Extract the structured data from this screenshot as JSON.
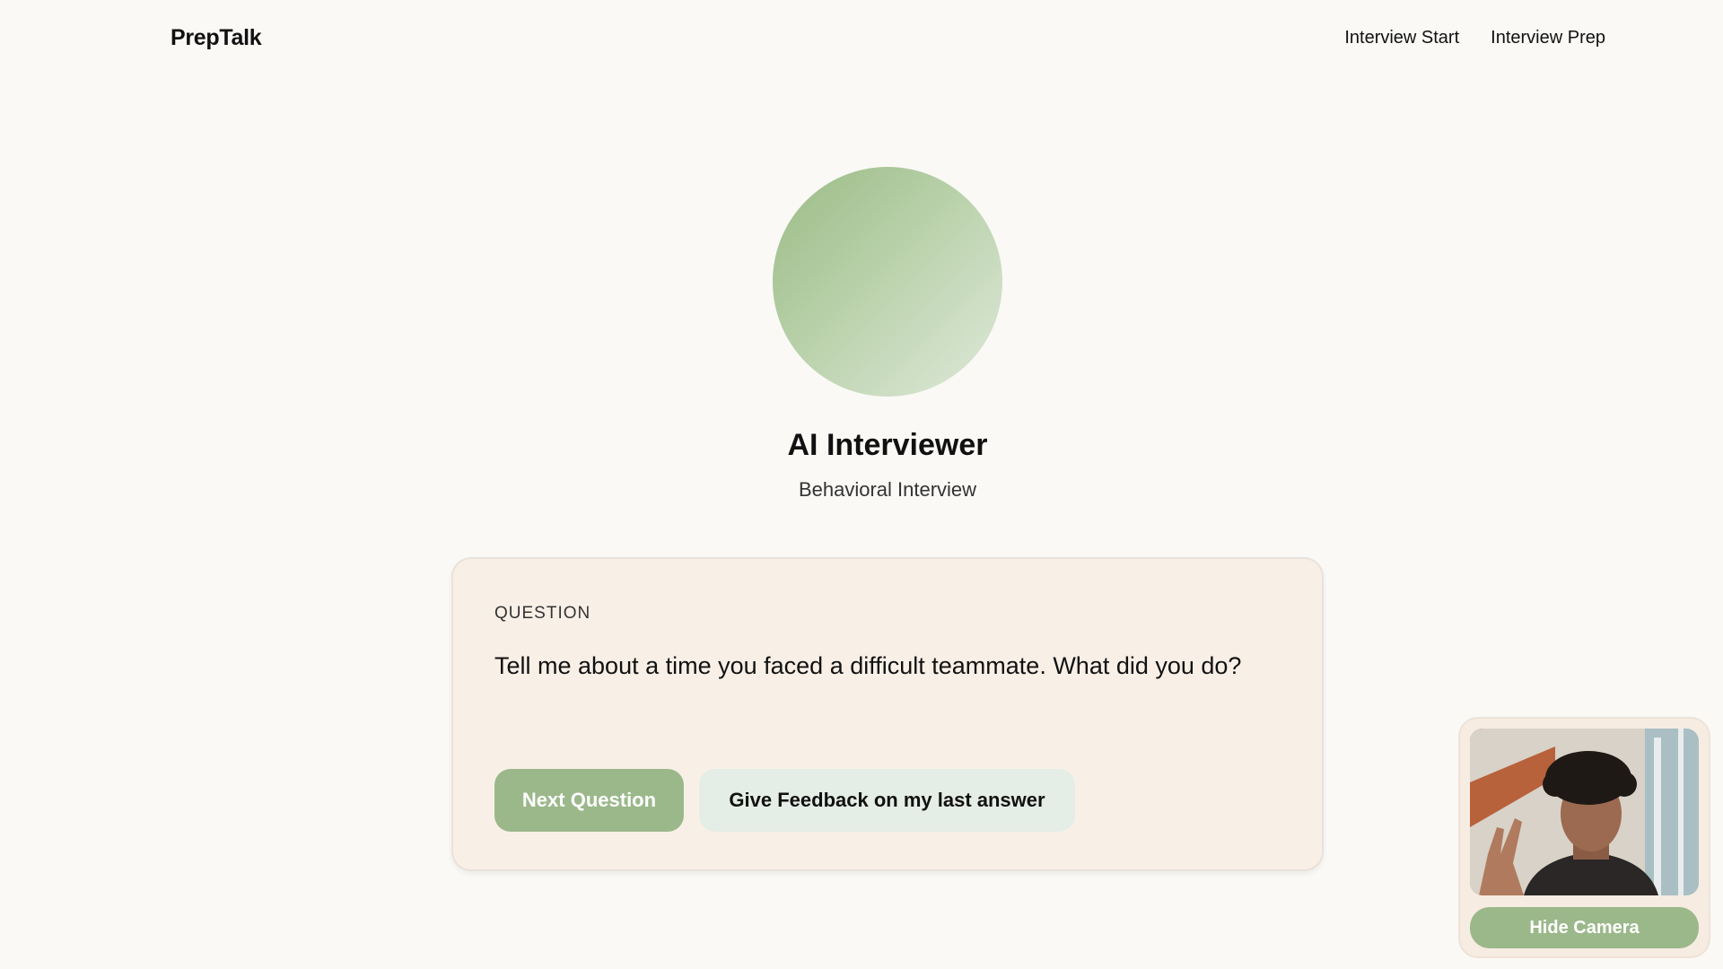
{
  "header": {
    "brand": "PrepTalk",
    "nav": [
      {
        "label": "Interview Start"
      },
      {
        "label": "Interview Prep"
      }
    ]
  },
  "interviewer": {
    "name": "AI Interviewer",
    "type": "Behavioral Interview"
  },
  "question_card": {
    "label": "QUESTION",
    "text": "Tell me about a time you faced a difficult teammate. What did you do?",
    "next_button": "Next Question",
    "feedback_button": "Give Feedback on my last answer"
  },
  "camera": {
    "hide_button": "Hide Camera"
  },
  "colors": {
    "background": "#faf9f6",
    "accent_green": "#9bb88a",
    "card_bg": "#f8f0e7",
    "feedback_bg": "#e4ede6"
  }
}
